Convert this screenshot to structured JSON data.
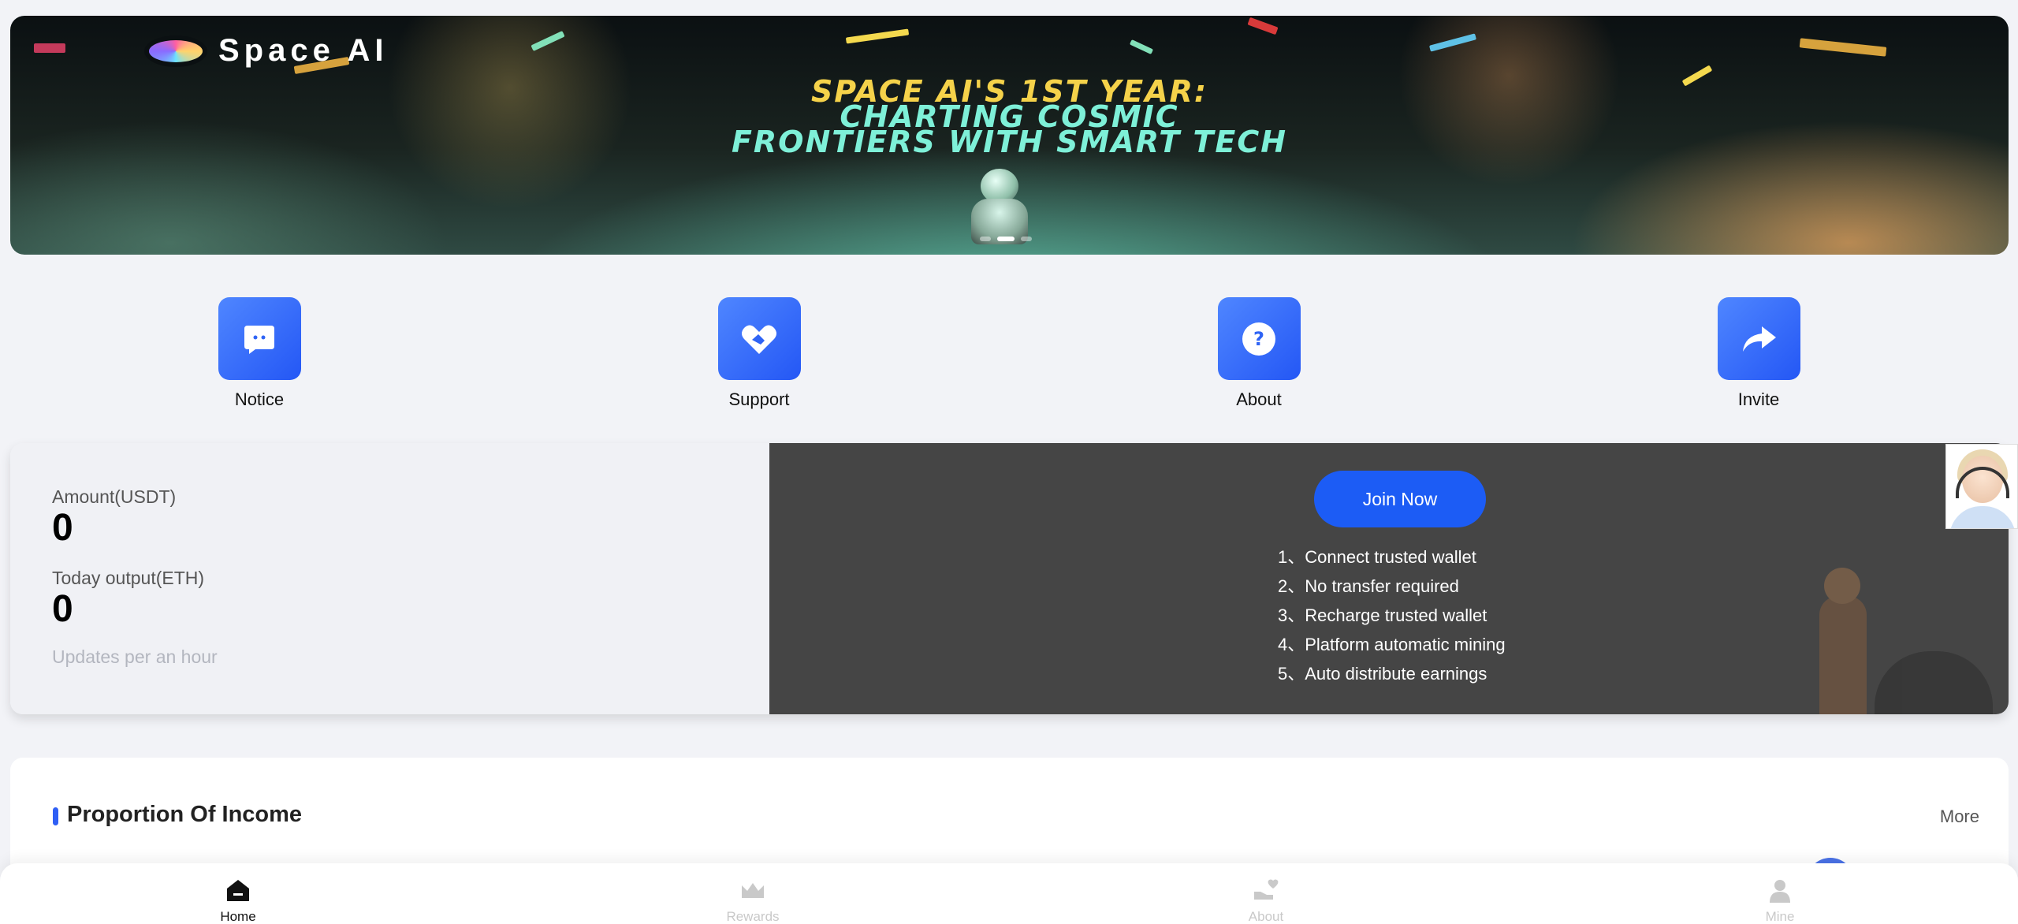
{
  "banner": {
    "logo_text": "Space  AI",
    "headline_line1": "SPACE AI'S 1ST YEAR:",
    "headline_line2": "CHARTING COSMIC",
    "headline_line3": "FRONTIERS WITH SMART TECH",
    "slide_count": 3,
    "active_slide": 2
  },
  "quick_menu": [
    {
      "label": "Notice",
      "icon": "chat-icon"
    },
    {
      "label": "Support",
      "icon": "handshake-icon"
    },
    {
      "label": "About",
      "icon": "question-icon"
    },
    {
      "label": "Invite",
      "icon": "share-arrow-icon"
    }
  ],
  "mining": {
    "amount_label": "Amount(USDT)",
    "amount_value": "0",
    "output_label": "Today output(ETH)",
    "output_value": "0",
    "update_note": "Updates per an hour",
    "join_button": "Join Now",
    "more_label": "Mo",
    "steps": [
      "1、Connect trusted wallet",
      "2、No transfer required",
      "3、Recharge trusted wallet",
      "4、Platform automatic mining",
      "5、Auto distribute earnings"
    ]
  },
  "income": {
    "title": "Proportion Of Income",
    "more": "More"
  },
  "tabbar": [
    {
      "label": "Home",
      "icon": "home-icon",
      "active": true
    },
    {
      "label": "Rewards",
      "icon": "crown-icon",
      "active": false
    },
    {
      "label": "About",
      "icon": "hand-heart-icon",
      "active": false
    },
    {
      "label": "Mine",
      "icon": "user-icon",
      "active": false
    }
  ],
  "colors": {
    "accent": "#2457f5",
    "page_bg": "#f2f3f7",
    "dark_panel": "#454545"
  }
}
